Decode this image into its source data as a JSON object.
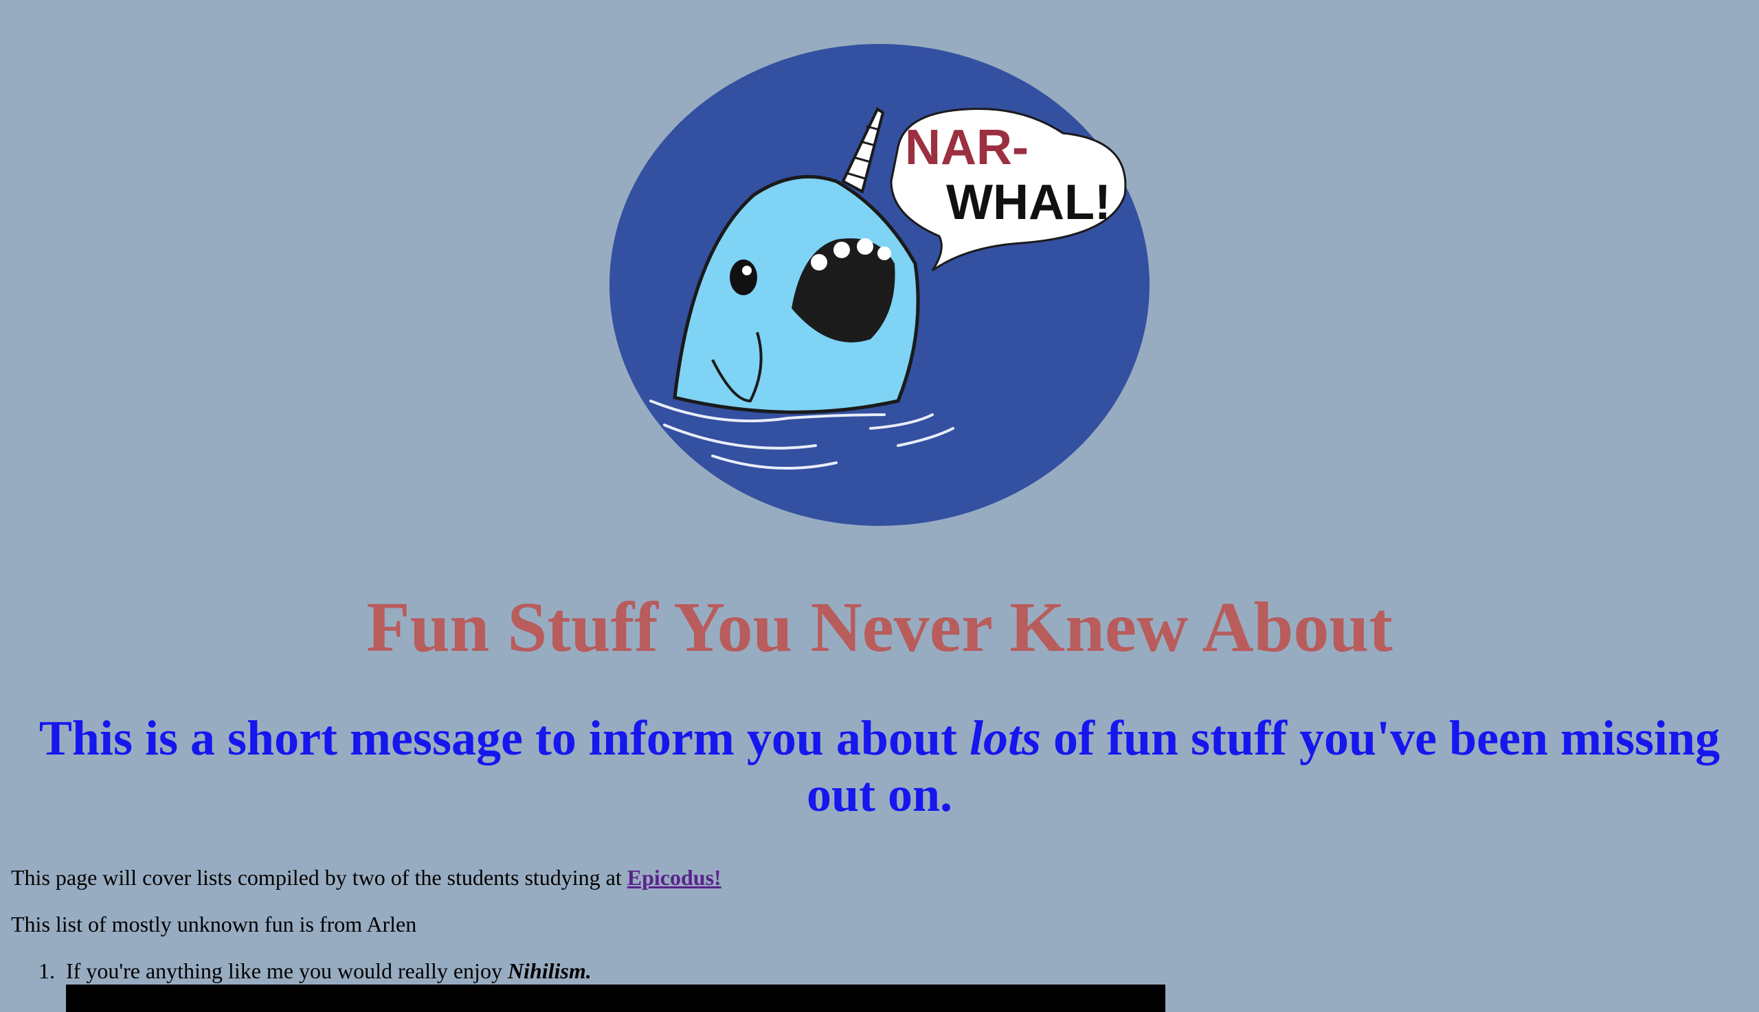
{
  "logo": {
    "speech_line1": "NAR-",
    "speech_line2": "WHAL!",
    "colors": {
      "circle": "#3450a0",
      "narwhal": "#7fd3f4",
      "speech_red": "#9b3040"
    }
  },
  "title": "Fun Stuff You Never Knew About",
  "message": {
    "before": "This is a short message to inform you about ",
    "emphasis": "lots",
    "after": " of fun stuff you've been missing out on."
  },
  "intro": {
    "text": "This page will cover lists compiled by two of the students studying at ",
    "link_label": "Epicodus!"
  },
  "list_intro": "This list of mostly unknown fun is from Arlen",
  "list": [
    {
      "number": "1.",
      "text": "If you're anything like me you would really enjoy ",
      "emphasis": "Nihilism."
    }
  ]
}
